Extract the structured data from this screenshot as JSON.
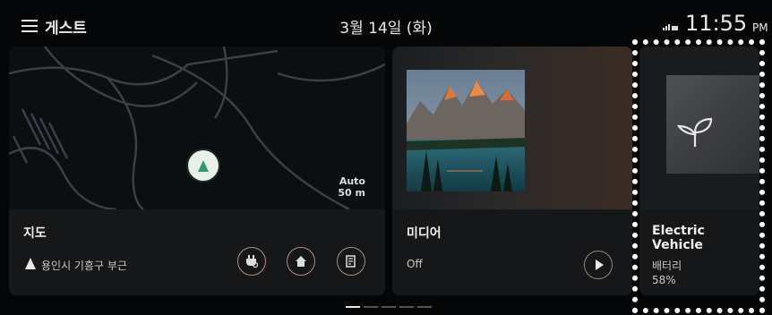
{
  "status_bar": {
    "user": "게스트",
    "date": "3월 14일 (화)",
    "time": "11:55",
    "ampm": "PM"
  },
  "map_card": {
    "title": "지도",
    "location": "용인시 기흥구 부근",
    "scale_mode": "Auto",
    "scale_distance": "50 m"
  },
  "media_card": {
    "title": "미디어",
    "status": "Off"
  },
  "ev_card": {
    "title_line1": "Electric",
    "title_line2": "Vehicle",
    "battery_label": "배터리",
    "battery_percent": "58%"
  },
  "pager": {
    "page_count": 5,
    "active_index": 0
  },
  "colors": {
    "background": "#050608",
    "card": "#151618",
    "button_ring": "#b58a80",
    "nav_marker": "#2e9a74"
  }
}
